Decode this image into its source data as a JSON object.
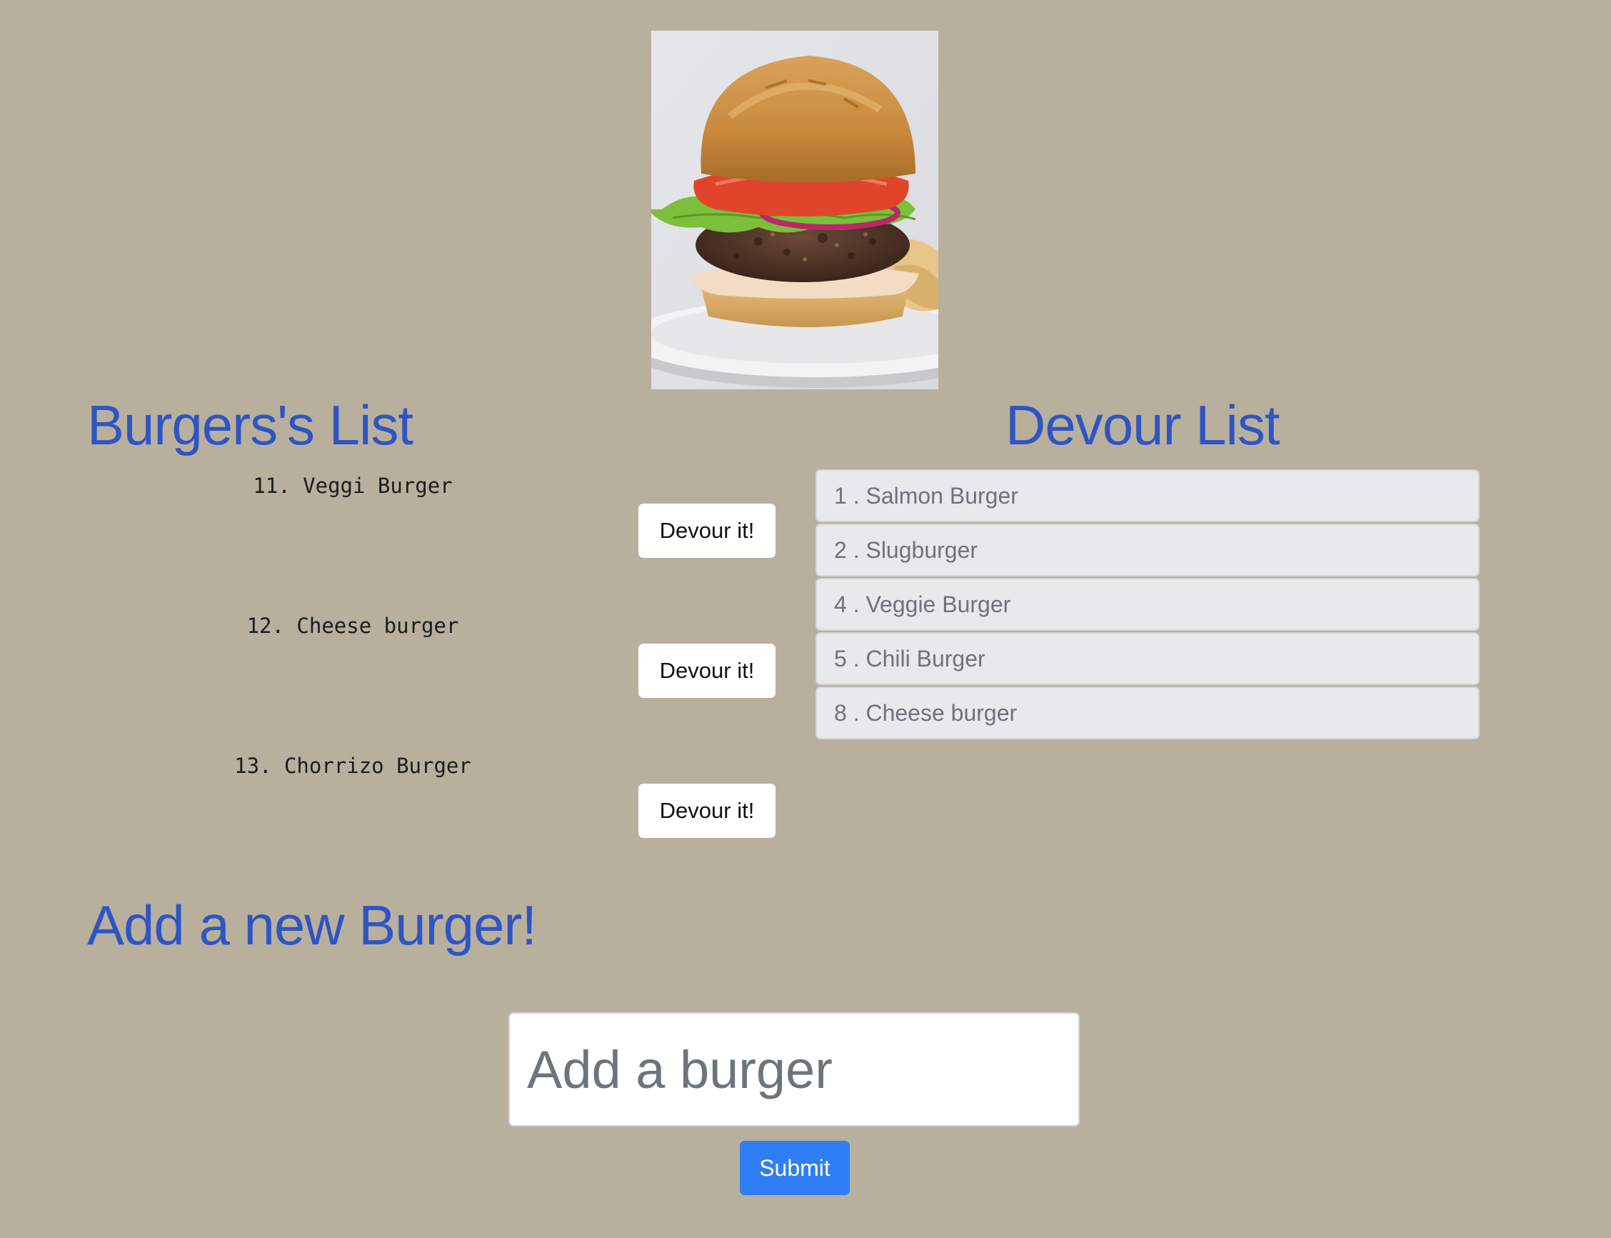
{
  "colors": {
    "page_background": "#b8b09d",
    "heading": "#2e55c3",
    "submit_button": "#2f7ef5",
    "devour_item_background": "#e8e9eb",
    "devour_item_text": "#6c737b"
  },
  "hero": {
    "image": "burger-photo"
  },
  "burgers_list": {
    "heading": "Burgers's List",
    "items": [
      {
        "label": "11. Veggi Burger",
        "button": "Devour it!"
      },
      {
        "label": "12. Cheese burger",
        "button": "Devour it!"
      },
      {
        "label": "13. Chorrizo Burger",
        "button": "Devour it!"
      }
    ]
  },
  "devour_list": {
    "heading": "Devour List",
    "items": [
      "1 . Salmon Burger",
      "2 . Slugburger",
      "4 . Veggie Burger",
      "5 . Chili Burger",
      "8 . Cheese burger"
    ]
  },
  "add_form": {
    "heading": "Add a new Burger!",
    "input_value": "",
    "input_placeholder": "Add a burger",
    "submit_label": "Submit"
  }
}
